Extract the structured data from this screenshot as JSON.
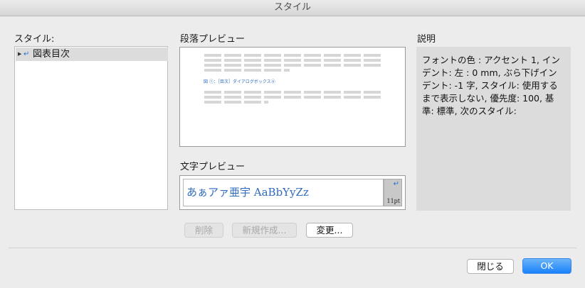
{
  "window": {
    "title": "スタイル"
  },
  "styles_panel": {
    "label": "スタイル:",
    "items": [
      {
        "label": "図表目次",
        "selected": true
      }
    ]
  },
  "paragraph_preview": {
    "label": "段落プレビュー",
    "caption_text": "図 ①：［目次］ダイアログボックス④"
  },
  "character_preview": {
    "label": "文字プレビュー",
    "sample_text": "あぁアァ亜宇 AaBbYyZz",
    "size_label": "11pt"
  },
  "description": {
    "label": "説明",
    "text": "フォントの色 : アクセント 1, インデント: 左 :  0 mm, ぶら下げインデント:  -1 字, スタイル: 使用するまで表示しない, 優先度: 100, 基準: 標準, 次のスタイル:"
  },
  "buttons": {
    "delete": "削除",
    "new": "新規作成...",
    "modify": "変更...",
    "close": "閉じる",
    "ok": "OK"
  },
  "colors": {
    "accent": "#2a6fd1",
    "preview_text": "#2f6bbd",
    "ok_button": "#1a82fb"
  }
}
